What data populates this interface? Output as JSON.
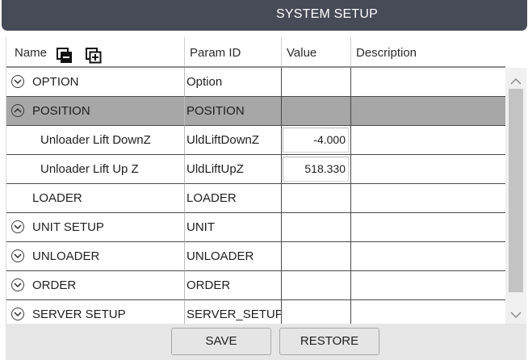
{
  "window": {
    "title": "SYSTEM SETUP"
  },
  "grid": {
    "columns": {
      "name": "Name",
      "param_id": "Param ID",
      "value": "Value",
      "description": "Description"
    },
    "header_icons": [
      "collapse-all-icon",
      "expand-all-icon"
    ],
    "rows": [
      {
        "name": "OPTION",
        "param_id": "Option",
        "value": "",
        "description": "",
        "type": "group",
        "expanded": false
      },
      {
        "name": "POSITION",
        "param_id": "POSITION",
        "value": "",
        "description": "",
        "type": "group",
        "expanded": true,
        "selected": true
      },
      {
        "name": "Unloader Lift DownZ",
        "param_id": "UldLiftDownZ",
        "value": "-4.000",
        "description": "",
        "type": "param"
      },
      {
        "name": "Unloader Lift Up Z",
        "param_id": "UldLiftUpZ",
        "value": "518.330",
        "description": "",
        "type": "param"
      },
      {
        "name": "LOADER",
        "param_id": "LOADER",
        "value": "",
        "description": "",
        "type": "group-noicon"
      },
      {
        "name": "UNIT SETUP",
        "param_id": "UNIT",
        "value": "",
        "description": "",
        "type": "group",
        "expanded": false
      },
      {
        "name": "UNLOADER",
        "param_id": "UNLOADER",
        "value": "",
        "description": "",
        "type": "group",
        "expanded": false
      },
      {
        "name": "ORDER",
        "param_id": "ORDER",
        "value": "",
        "description": "",
        "type": "group",
        "expanded": false
      },
      {
        "name": "SERVER SETUP",
        "param_id": "SERVER_SETUP",
        "value": "",
        "description": "",
        "type": "group",
        "expanded": false
      }
    ]
  },
  "footer": {
    "save_label": "SAVE",
    "restore_label": "RESTORE"
  },
  "colors": {
    "title_bg": "#474a57",
    "selected_row": "#a7a7a7",
    "footer_bg": "#e6e6e6"
  }
}
